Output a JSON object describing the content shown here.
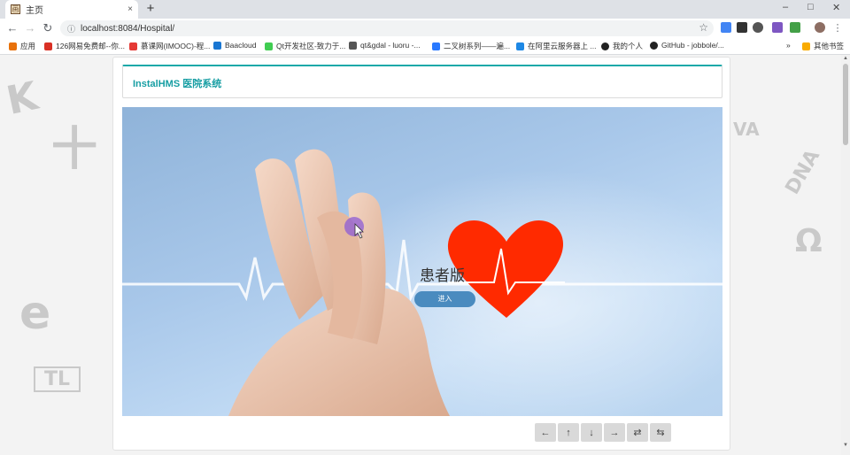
{
  "browser": {
    "tab_title": "主页",
    "tab_close": "×",
    "new_tab": "+",
    "window_controls": [
      "–",
      "□",
      "✕"
    ],
    "address": "localhost:8084/Hospital/",
    "nav": {
      "back": "←",
      "forward": "→",
      "reload": "↻",
      "info": "ⓘ",
      "star": "☆"
    },
    "bookmarks": [
      {
        "label": "应用",
        "icon": "apps-grid-icon",
        "color": "#e8710a"
      },
      {
        "label": "126网易免费邮--你...",
        "icon": "netease-icon",
        "color": "#d93025"
      },
      {
        "label": "慕课网(IMOOC)-程...",
        "icon": "imooc-icon",
        "color": "#e53935"
      },
      {
        "label": "Baacloud",
        "icon": "paper-plane-icon",
        "color": "#1976d2"
      },
      {
        "label": "Qt开发社区-致力于...",
        "icon": "qt-icon",
        "color": "#41cd52"
      },
      {
        "label": "qt&gdal - luoru -...",
        "icon": "qt-search-icon",
        "color": "#555555"
      },
      {
        "label": "二叉树系列——遍...",
        "icon": "ink-icon",
        "color": "#2979ff"
      },
      {
        "label": "在阿里云服务器上 ...",
        "icon": "blog-icon",
        "color": "#1e88e5"
      },
      {
        "label": "我的个人",
        "icon": "github-icon",
        "color": "#222222"
      },
      {
        "label": "GitHub - jobbole/...",
        "icon": "github-icon",
        "color": "#222222"
      }
    ],
    "bookmarks_more": "»",
    "other_bookmarks": "其他书签"
  },
  "page": {
    "brand": "InstalHMS 医院系统",
    "hero_title": "患者版",
    "enter_button": "进入",
    "carousel_controls": [
      {
        "name": "prev-arrow-icon",
        "glyph": "←"
      },
      {
        "name": "up-arrow-icon",
        "glyph": "↑"
      },
      {
        "name": "down-arrow-icon",
        "glyph": "↓"
      },
      {
        "name": "next-arrow-icon",
        "glyph": "→"
      },
      {
        "name": "repeat-icon",
        "glyph": "⇄"
      },
      {
        "name": "loop-icon",
        "glyph": "⇆"
      }
    ],
    "doodles": [
      "K",
      "十",
      "VA",
      "DNA",
      "Ω",
      "e",
      "TL"
    ],
    "colors": {
      "accent": "#179ea3",
      "button": "#4a8bbf",
      "heart": "#ff2a00"
    }
  }
}
